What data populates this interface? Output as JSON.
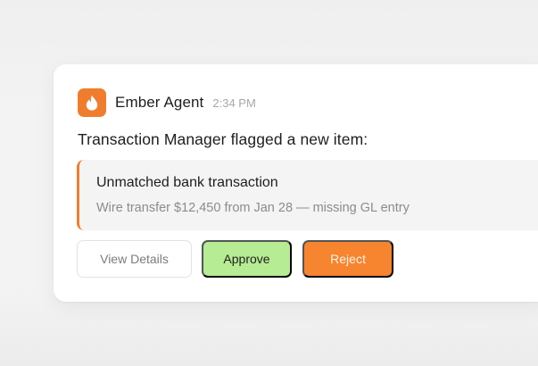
{
  "notification": {
    "agent_name": "Ember Agent",
    "timestamp": "2:34 PM",
    "app_icon": "flame-icon",
    "message": "Transaction Manager flagged a new item:",
    "item": {
      "title": "Unmatched bank transaction",
      "detail": "Wire transfer $12,450 from Jan 28 — missing GL entry"
    },
    "actions": {
      "view_details_label": "View Details",
      "approve_label": "Approve",
      "reject_label": "Reject"
    }
  },
  "colors": {
    "accent": "#f07d2e",
    "approve": "#b6ec93",
    "reject": "#f7842f"
  }
}
